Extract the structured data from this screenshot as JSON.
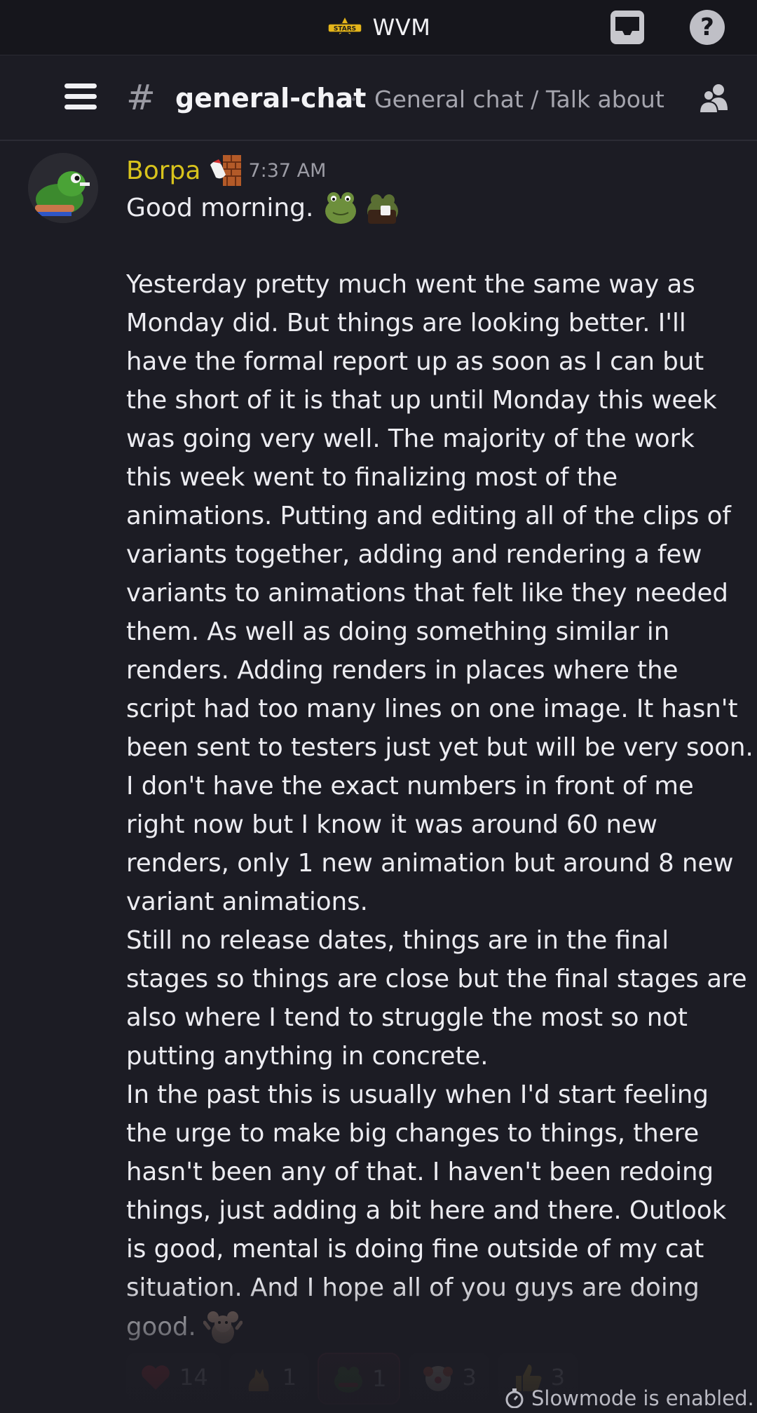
{
  "server": {
    "name": "WVM",
    "logo_text": "STARS"
  },
  "channel": {
    "name": "general-chat",
    "topic": "General chat / Talk about ..."
  },
  "message": {
    "author": "Borpa",
    "time": "7:37 AM",
    "greeting": "Good morning.",
    "lines": [
      "Yesterday pretty much went the same way as",
      "Monday did. But things are looking better. I'll",
      "have the formal report up as soon as I can but",
      "the short of it is that up until Monday this week",
      "was going very well. The majority of the work",
      "this week went to finalizing most of the",
      "animations. Putting and editing all of the clips of",
      "variants together, adding and rendering a few",
      "variants to animations that felt like they needed",
      "them. As well as doing something similar in",
      "renders. Adding renders in places where the",
      "script had too many lines on one image. It hasn't",
      "been sent to testers just yet but will be very soon.",
      "I don't have the exact numbers in front of me",
      "right now but I know it was around 60 new",
      "renders, only 1 new animation but around 8 new",
      "variant animations.",
      "Still no release dates, things are in the final",
      "stages so things are close but the final stages are",
      "also where I tend to struggle the most so not",
      "putting anything in concrete.",
      "In the past this is usually when I'd start feeling",
      "the urge to make big changes to things, there",
      "hasn't been any of that. I haven't been redoing",
      "things, just adding a bit here and there. Outlook",
      "is good, mental is doing fine outside of my cat",
      "situation. And I hope all of you guys are doing"
    ],
    "last_line": "good."
  },
  "reactions": [
    {
      "icon": "heart-icon",
      "count": "14",
      "color": "#d9303e"
    },
    {
      "icon": "cat-icon",
      "count": "1",
      "color": "#d89a3a"
    },
    {
      "icon": "frog-icon",
      "count": "1",
      "color": "#3f7a2c"
    },
    {
      "icon": "clown-icon",
      "count": "3",
      "color": "#f0b64a"
    },
    {
      "icon": "thumbs-up-icon",
      "count": "3",
      "color": "#f2c23a"
    }
  ],
  "footer": {
    "slowmode": "Slowmode is enabled."
  },
  "colors": {
    "background": "#1c1c24",
    "author": "#d8c31c",
    "accent": "#d9303e"
  }
}
